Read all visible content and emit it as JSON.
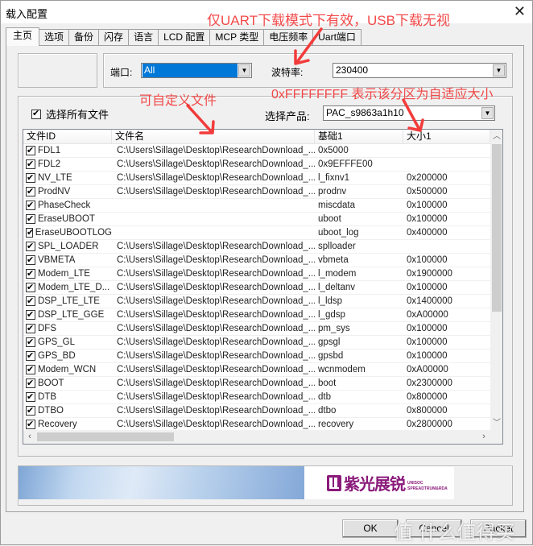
{
  "window": {
    "title": "载入配置",
    "close_icon": "close-icon"
  },
  "tabs": [
    {
      "label": "主页",
      "active": true
    },
    {
      "label": "选项"
    },
    {
      "label": "备份"
    },
    {
      "label": "闪存"
    },
    {
      "label": "语言"
    },
    {
      "label": "LCD 配置"
    },
    {
      "label": "MCP 类型"
    },
    {
      "label": "电压频率"
    },
    {
      "label": "Uart端口"
    }
  ],
  "port": {
    "label": "端口:",
    "value": "All"
  },
  "baud": {
    "label": "波特率:",
    "value": "230400"
  },
  "select_all": {
    "label": "选择所有文件",
    "checked": true
  },
  "product": {
    "label": "选择产品:",
    "value": "PAC_s9863a1h10"
  },
  "file_table": {
    "columns": [
      "文件ID",
      "文件名",
      "基础1",
      "大小1"
    ],
    "rows": [
      {
        "checked": true,
        "id": "FDL1",
        "file": "C:\\Users\\Sillage\\Desktop\\ResearchDownload_...",
        "base": "0x5000",
        "size": ""
      },
      {
        "checked": true,
        "id": "FDL2",
        "file": "C:\\Users\\Sillage\\Desktop\\ResearchDownload_...",
        "base": "0x9EFFFE00",
        "size": ""
      },
      {
        "checked": true,
        "id": "NV_LTE",
        "file": "C:\\Users\\Sillage\\Desktop\\ResearchDownload_...",
        "base": "l_fixnv1",
        "size": "0x200000"
      },
      {
        "checked": true,
        "id": "ProdNV",
        "file": "C:\\Users\\Sillage\\Desktop\\ResearchDownload_...",
        "base": "prodnv",
        "size": "0x500000"
      },
      {
        "checked": true,
        "id": "PhaseCheck",
        "file": "",
        "base": "miscdata",
        "size": "0x100000"
      },
      {
        "checked": true,
        "id": "EraseUBOOT",
        "file": "",
        "base": "uboot",
        "size": "0x100000"
      },
      {
        "checked": true,
        "id": "EraseUBOOTLOG",
        "file": "",
        "base": "uboot_log",
        "size": "0x400000"
      },
      {
        "checked": true,
        "id": "SPL_LOADER",
        "file": "C:\\Users\\Sillage\\Desktop\\ResearchDownload_...",
        "base": "splloader",
        "size": ""
      },
      {
        "checked": true,
        "id": "VBMETA",
        "file": "C:\\Users\\Sillage\\Desktop\\ResearchDownload_...",
        "base": "vbmeta",
        "size": "0x100000"
      },
      {
        "checked": true,
        "id": "Modem_LTE",
        "file": "C:\\Users\\Sillage\\Desktop\\ResearchDownload_...",
        "base": "l_modem",
        "size": "0x1900000"
      },
      {
        "checked": true,
        "id": "Modem_LTE_D...",
        "file": "C:\\Users\\Sillage\\Desktop\\ResearchDownload_...",
        "base": "l_deltanv",
        "size": "0x100000"
      },
      {
        "checked": true,
        "id": "DSP_LTE_LTE",
        "file": "C:\\Users\\Sillage\\Desktop\\ResearchDownload_...",
        "base": "l_ldsp",
        "size": "0x1400000"
      },
      {
        "checked": true,
        "id": "DSP_LTE_GGE",
        "file": "C:\\Users\\Sillage\\Desktop\\ResearchDownload_...",
        "base": "l_gdsp",
        "size": "0xA00000"
      },
      {
        "checked": true,
        "id": "DFS",
        "file": "C:\\Users\\Sillage\\Desktop\\ResearchDownload_...",
        "base": "pm_sys",
        "size": "0x100000"
      },
      {
        "checked": true,
        "id": "GPS_GL",
        "file": "C:\\Users\\Sillage\\Desktop\\ResearchDownload_...",
        "base": "gpsgl",
        "size": "0x100000"
      },
      {
        "checked": true,
        "id": "GPS_BD",
        "file": "C:\\Users\\Sillage\\Desktop\\ResearchDownload_...",
        "base": "gpsbd",
        "size": "0x100000"
      },
      {
        "checked": true,
        "id": "Modem_WCN",
        "file": "C:\\Users\\Sillage\\Desktop\\ResearchDownload_...",
        "base": "wcnmodem",
        "size": "0xA00000"
      },
      {
        "checked": true,
        "id": "BOOT",
        "file": "C:\\Users\\Sillage\\Desktop\\ResearchDownload_...",
        "base": "boot",
        "size": "0x2300000"
      },
      {
        "checked": true,
        "id": "DTB",
        "file": "C:\\Users\\Sillage\\Desktop\\ResearchDownload_...",
        "base": "dtb",
        "size": "0x800000"
      },
      {
        "checked": true,
        "id": "DTBO",
        "file": "C:\\Users\\Sillage\\Desktop\\ResearchDownload_...",
        "base": "dtbo",
        "size": "0x800000"
      },
      {
        "checked": true,
        "id": "Recovery",
        "file": "C:\\Users\\Sillage\\Desktop\\ResearchDownload_...",
        "base": "recovery",
        "size": "0x2800000"
      }
    ]
  },
  "banner": {
    "logo_text": "紫光展锐",
    "logo_en_1": "UNISOC",
    "logo_en_2": "SPREADTRUM&RDA"
  },
  "buttons": {
    "ok": "OK",
    "cancel": "Cancel",
    "packet": "Packet"
  },
  "annotations": {
    "uart_note": "仅UART下载模式下有效，USB下载无视",
    "custom_file_note": "可自定义文件",
    "size_note": "0xFFFFFFFF 表示该分区为自适应大小",
    "color": "#f23b3b"
  },
  "watermark": "值 什么值得买"
}
